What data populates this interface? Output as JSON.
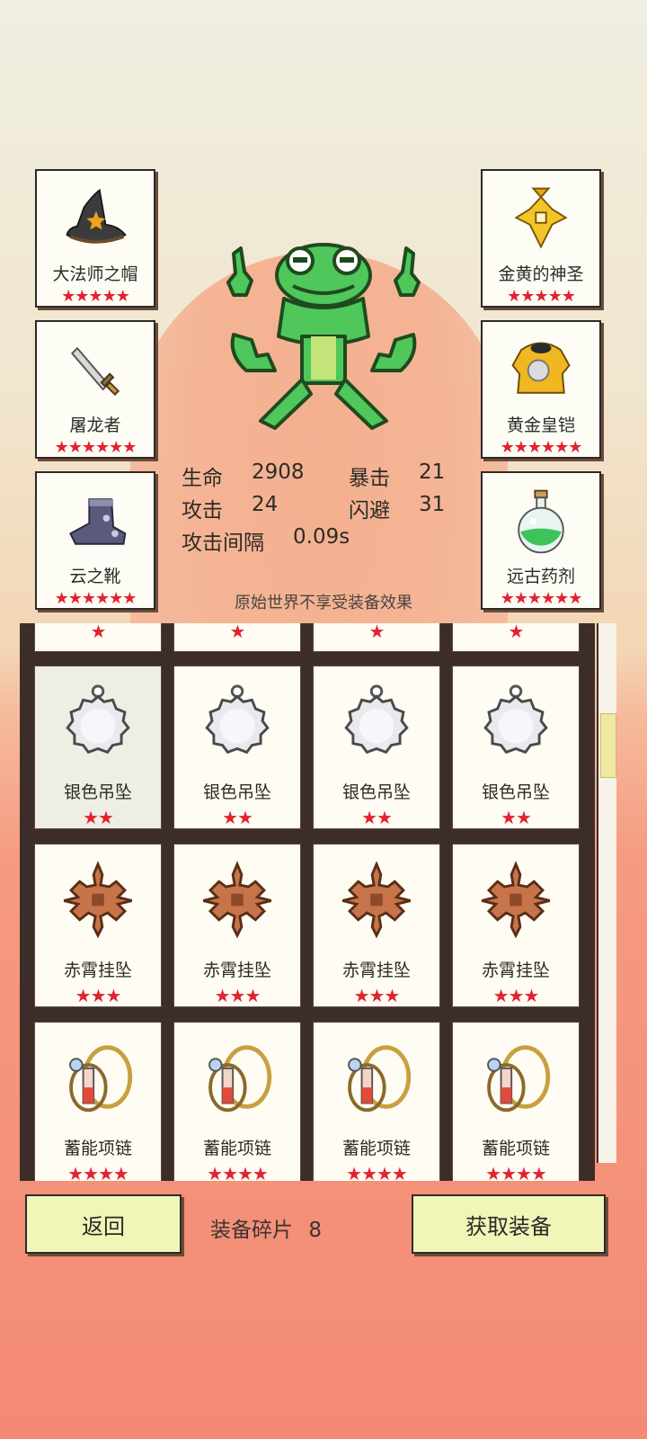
{
  "equipment_left": [
    {
      "name": "大法师之帽",
      "stars": "★★★★★",
      "icon": "wizard-hat-icon"
    },
    {
      "name": "屠龙者",
      "stars": "★★★★★★",
      "icon": "dagger-icon"
    },
    {
      "name": "云之靴",
      "stars": "★★★★★★",
      "icon": "boot-icon"
    }
  ],
  "equipment_right": [
    {
      "name": "金黄的神圣",
      "stars": "★★★★★",
      "icon": "golden-amulet-icon"
    },
    {
      "name": "黄金皇铠",
      "stars": "★★★★★★",
      "icon": "golden-armor-icon"
    },
    {
      "name": "远古药剂",
      "stars": "★★★★★★",
      "icon": "potion-icon"
    }
  ],
  "stats": {
    "hp_label": "生命",
    "hp_value": "2908",
    "crit_label": "暴击",
    "crit_value": "21",
    "atk_label": "攻击",
    "atk_value": "24",
    "dodge_label": "闪避",
    "dodge_value": "31",
    "interval_label": "攻击间隔",
    "interval_value": "0.09s"
  },
  "note": "原始世界不享受装备效果",
  "inventory": {
    "partial_row_stars": "★",
    "rows": [
      {
        "name": "银色吊坠",
        "stars": "★★",
        "icon": "silver-pendant-icon"
      },
      {
        "name": "赤霄挂坠",
        "stars": "★★★",
        "icon": "copper-pendant-icon"
      },
      {
        "name": "蓄能项链",
        "stars": "★★★★",
        "icon": "energy-necklace-icon"
      }
    ]
  },
  "bottom": {
    "back_label": "返回",
    "fragments_label": "装备碎片",
    "fragments_value": "8",
    "get_label": "获取装备"
  },
  "colors": {
    "star": "#e22230",
    "button_bg": "#f0f6b8",
    "panel_dark": "#3d2d29"
  }
}
